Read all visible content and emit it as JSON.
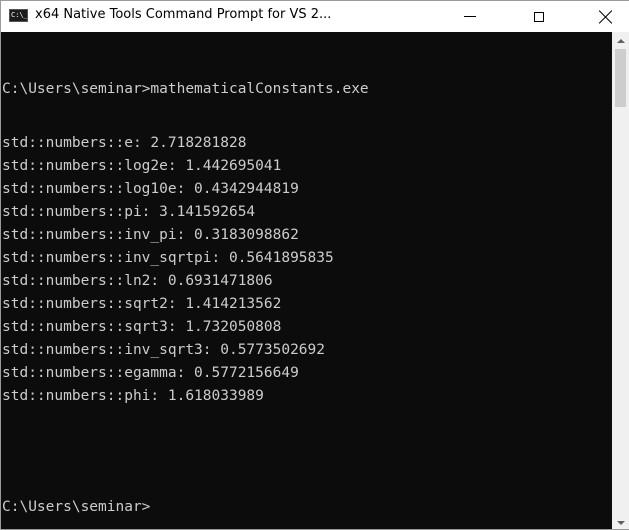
{
  "window": {
    "title": "x64 Native Tools Command Prompt for VS 2...",
    "icon_text": "C:\\_",
    "buttons": {
      "minimize": "minimize-icon",
      "maximize": "maximize-icon",
      "close": "close-icon"
    }
  },
  "console": {
    "lines": [
      "C:\\Users\\seminar>mathematicalConstants.exe",
      "std::numbers::e: 2.718281828",
      "std::numbers::log2e: 1.442695041",
      "std::numbers::log10e: 0.4342944819",
      "std::numbers::pi: 3.141592654",
      "std::numbers::inv_pi: 0.3183098862",
      "std::numbers::inv_sqrtpi: 0.5641895835",
      "std::numbers::ln2: 0.6931471806",
      "std::numbers::sqrt2: 1.414213562",
      "std::numbers::sqrt3: 1.732050808",
      "std::numbers::inv_sqrt3: 0.5773502692",
      "std::numbers::egamma: 0.5772156649",
      "std::numbers::phi: 1.618033989",
      "C:\\Users\\seminar>"
    ]
  },
  "colors": {
    "background": "#0c0c0c",
    "text": "#cccccc",
    "titlebar": "#ffffff"
  }
}
